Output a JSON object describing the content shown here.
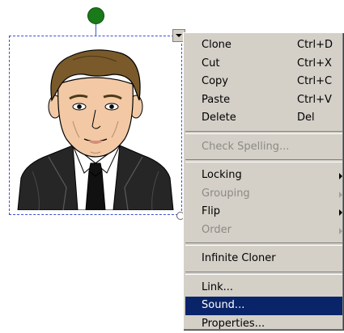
{
  "canvas": {
    "selection_color": "#3a4fd0",
    "rotate_handle_color": "#1a7a1a",
    "image_subject": "portrait-clipart"
  },
  "menu": {
    "highlight_color": "#0a246a",
    "items": [
      {
        "label": "Clone",
        "shortcut": "Ctrl+D"
      },
      {
        "label": "Cut",
        "shortcut": "Ctrl+X"
      },
      {
        "label": "Copy",
        "shortcut": "Ctrl+C"
      },
      {
        "label": "Paste",
        "shortcut": "Ctrl+V"
      },
      {
        "label": "Delete",
        "shortcut": "Del"
      },
      {
        "label": "Check Spelling..."
      },
      {
        "label": "Locking"
      },
      {
        "label": "Grouping"
      },
      {
        "label": "Flip"
      },
      {
        "label": "Order"
      },
      {
        "label": "Infinite Cloner"
      },
      {
        "label": "Link..."
      },
      {
        "label": "Sound..."
      },
      {
        "label": "Properties..."
      }
    ]
  }
}
